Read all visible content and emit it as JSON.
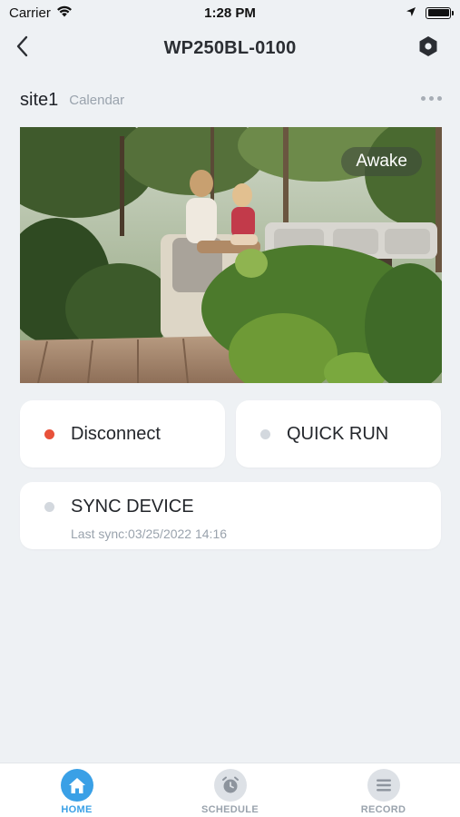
{
  "status_bar": {
    "carrier": "Carrier",
    "time": "1:28 PM"
  },
  "nav": {
    "title": "WP250BL-0100",
    "back_icon": "chevron-left-icon",
    "settings_icon": "hexagon-gear-icon"
  },
  "site": {
    "name": "site1",
    "calendar_label": "Calendar",
    "more_icon": "more-horizontal-icon"
  },
  "camera": {
    "status_badge": "Awake"
  },
  "cards": {
    "disconnect": {
      "label": "Disconnect",
      "dot_color": "#e8513a"
    },
    "quick_run": {
      "label": "QUICK RUN",
      "dot_color": "#d3d8de"
    },
    "sync_device": {
      "label": "SYNC DEVICE",
      "last_sync": "Last sync:03/25/2022 14:16",
      "dot_color": "#d3d8de"
    }
  },
  "tabs": [
    {
      "label": "HOME",
      "icon": "home-icon",
      "active": true
    },
    {
      "label": "SCHEDULE",
      "icon": "alarm-clock-icon",
      "active": false
    },
    {
      "label": "RECORD",
      "icon": "list-icon",
      "active": false
    }
  ],
  "colors": {
    "accent": "#3aa0e6",
    "inactive": "#9aa3ad",
    "background": "#eef1f4"
  }
}
